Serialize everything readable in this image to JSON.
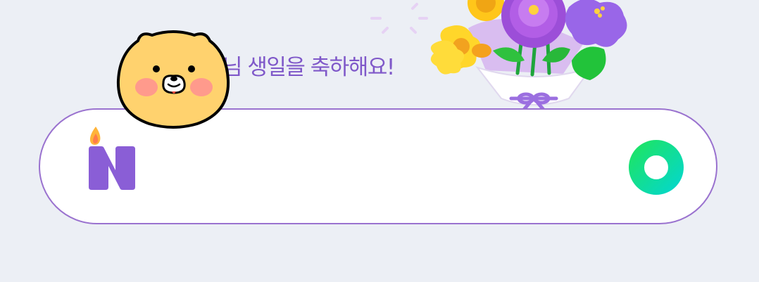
{
  "greeting": {
    "text": "님 생일을 축하해요!"
  },
  "search": {
    "placeholder": "",
    "value": "",
    "logo_icon": "naver-birthday-candle-logo-icon",
    "submit_icon": "green-ring-search-icon"
  },
  "decorations": {
    "bouquet_icon": "flower-bouquet-icon",
    "character_icon": "choonsik-character-icon"
  },
  "colors": {
    "background": "#eceff5",
    "accent_purple": "#8a5ed6",
    "search_border": "#9a72cf",
    "search_button_green": "#10e07a"
  }
}
